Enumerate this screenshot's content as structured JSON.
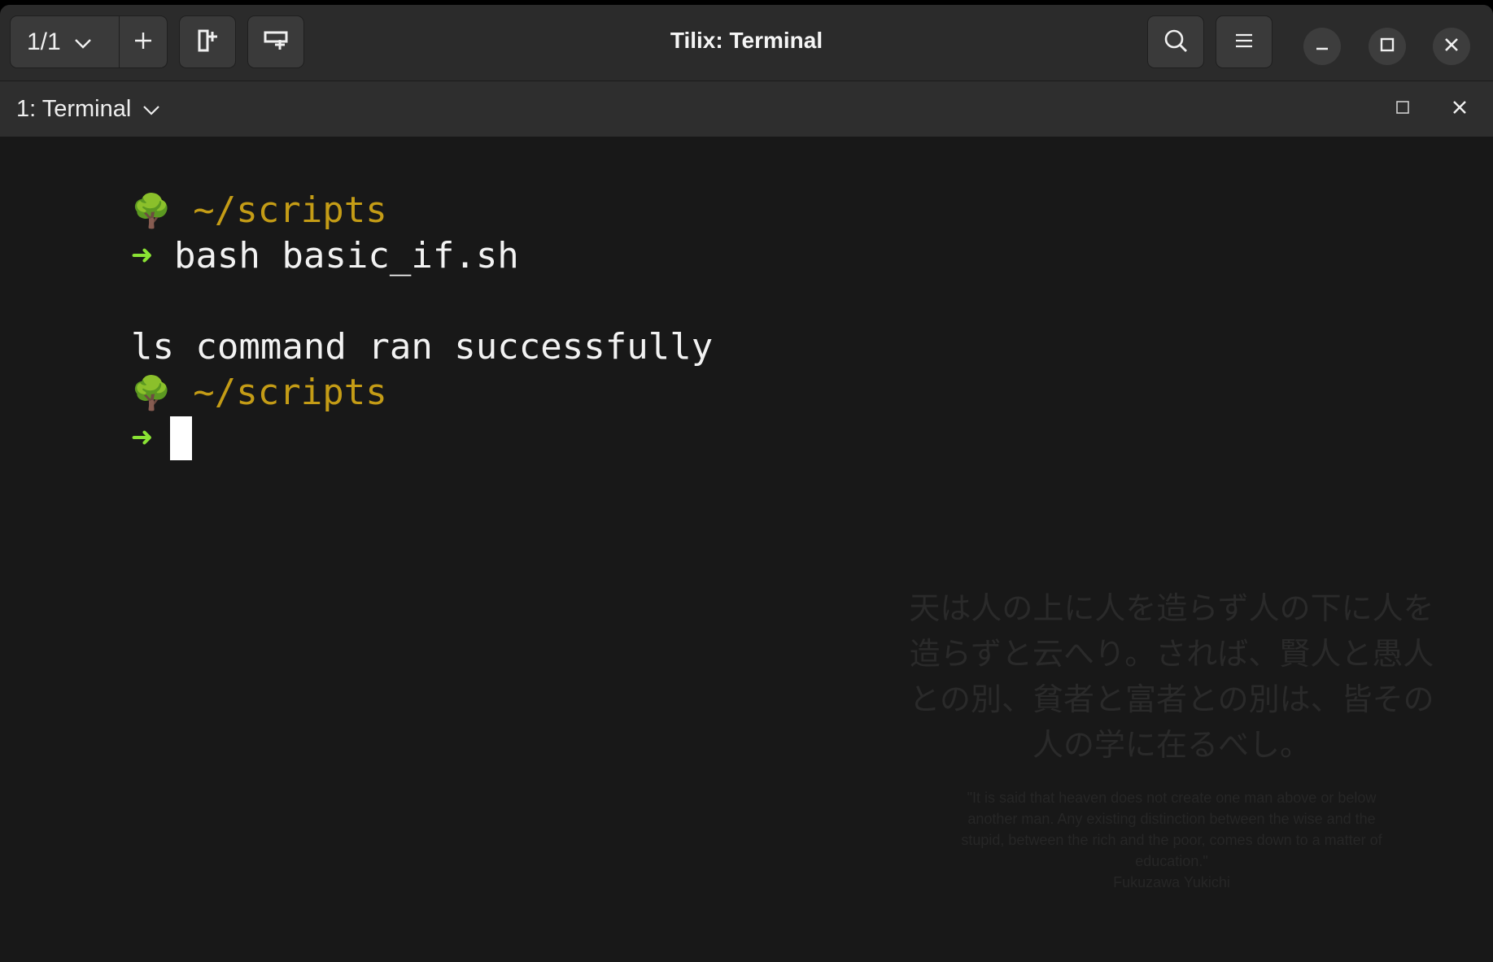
{
  "window": {
    "title": "Tilix: Terminal"
  },
  "header": {
    "session_switcher": {
      "label": "1/1",
      "icon": "chevron-down-icon"
    },
    "buttons": {
      "add_session_icon": "plus-icon",
      "split_right_icon": "split-horizontal-icon",
      "split_down_icon": "split-vertical-icon",
      "search_icon": "search-icon",
      "menu_icon": "hamburger-menu-icon",
      "minimize_icon": "minimize-icon",
      "maximize_icon": "maximize-icon",
      "close_icon": "close-icon"
    }
  },
  "pane": {
    "title": "1: Terminal",
    "dropdown_icon": "chevron-down-icon",
    "maximize_icon": "maximize-icon",
    "close_icon": "close-icon"
  },
  "terminal": {
    "prompt1_dir": "~/scripts",
    "prompt_arrow": "➜",
    "command1": "bash basic_if.sh",
    "output1": "ls command ran successfully",
    "prompt2_dir": "~/scripts",
    "tree_glyph": "🌳"
  },
  "watermark": {
    "japanese": "天は人の上に人を造らず人の下に人を造らずと云へり。されば、賢人と愚人との別、貧者と富者との別は、皆その人の学に在るべし。",
    "english": "\"It is said that heaven does not create one man above or below another man. Any existing distinction between the wise and the stupid, between the rich and the poor, comes down to a matter of education.\"",
    "author": "Fukuzawa Yukichi"
  },
  "colors": {
    "prompt_dir": "#c49c16",
    "prompt_arrow": "#8ae234",
    "terminal_bg": "#181818",
    "header_bg": "#2b2b2b"
  }
}
